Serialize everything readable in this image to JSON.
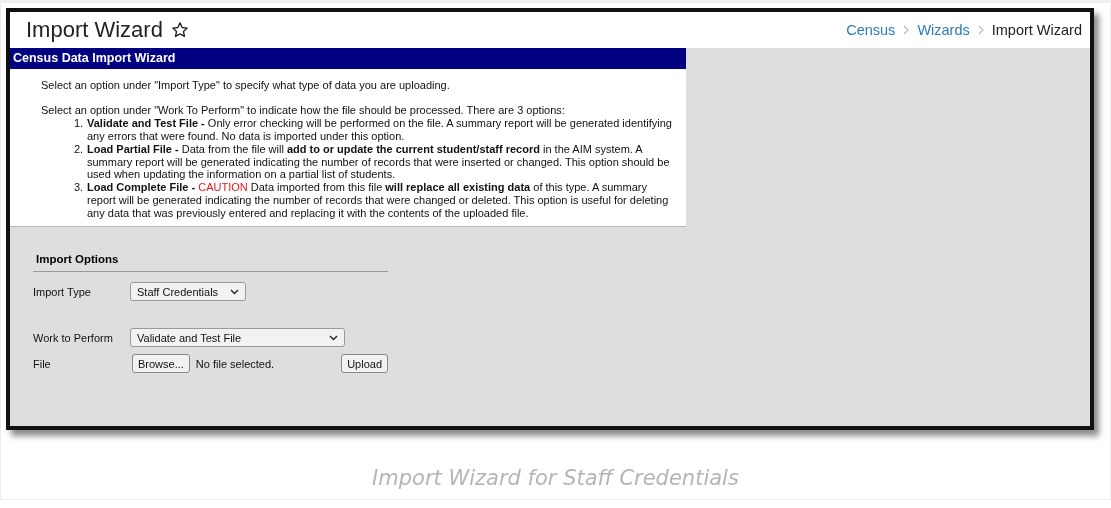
{
  "header": {
    "title": "Import Wizard",
    "breadcrumbs": [
      {
        "label": "Census",
        "kind": "link"
      },
      {
        "label": "Wizards",
        "kind": "link"
      },
      {
        "label": "Import Wizard",
        "kind": "current"
      }
    ]
  },
  "panel": {
    "title": "Census Data Import Wizard",
    "intro": "Select an option under \"Import Type\" to specify what type of data you are uploading.",
    "lead": "Select an option under \"Work To Perform\" to indicate how the file should be processed. There are 3 options:",
    "options": [
      {
        "number": "1.",
        "name": "Validate and Test File -",
        "text": "Only error checking will be performed on the file. A summary report will be generated identifying any errors that were found. No data is imported under this option."
      },
      {
        "number": "2.",
        "name": "Load Partial File -",
        "text": "Data from the file will **add to or update the current student/staff record** in the AIM system. A summary report will be generated indicating the number of records that were inserted or changed. This option should be used when updating the information on a partial list of students."
      },
      {
        "number": "3.",
        "name": "Load Complete File -",
        "caution": "CAUTION",
        "text": "Data imported from this file **will replace all existing data** of this type. A summary report will be generated indicating the number of records that were changed or deleted. This option is useful for deleting any data that was previously entered and replacing it with the contents of the uploaded file."
      }
    ]
  },
  "import_options": {
    "title": "Import Options",
    "fields": [
      {
        "kind": "select",
        "label": "Import Type",
        "value": "Staff Credentials"
      },
      {
        "kind": "select",
        "label": "Work to Perform",
        "value": "Validate and Test File"
      },
      {
        "kind": "file",
        "label": "File",
        "browse": "Browse...",
        "status": "No file selected.",
        "upload": "Upload"
      }
    ]
  },
  "caption": "Import Wizard for Staff Credentials"
}
